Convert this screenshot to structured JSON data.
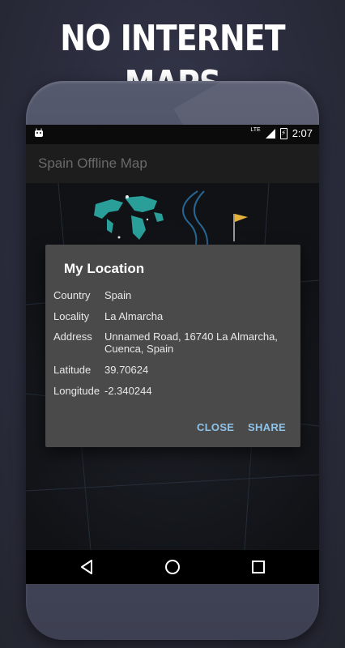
{
  "promo": {
    "title": "NO INTERNET MAPS"
  },
  "status_bar": {
    "network": "LTE",
    "time": "2:07"
  },
  "app_bar": {
    "title": "Spain Offline Map"
  },
  "dialog": {
    "title": "My Location",
    "rows": [
      {
        "label": "Country",
        "value": "Spain"
      },
      {
        "label": "Locality",
        "value": "La Almarcha"
      },
      {
        "label": "Address",
        "value": "Unnamed Road, 16740 La Almarcha, Cuenca, Spain"
      },
      {
        "label": "Latitude",
        "value": "39.70624"
      },
      {
        "label": "Longitude",
        "value": "-2.340244"
      }
    ],
    "close_label": "CLOSE",
    "share_label": "SHARE"
  },
  "nav_bar": {
    "icons": [
      "back-triangle-icon",
      "home-circle-icon",
      "recents-square-icon"
    ]
  },
  "colors": {
    "accent": "#8fc3e8",
    "dialog_bg": "#4a4a4a",
    "map_teal": "#2fb7b0"
  }
}
